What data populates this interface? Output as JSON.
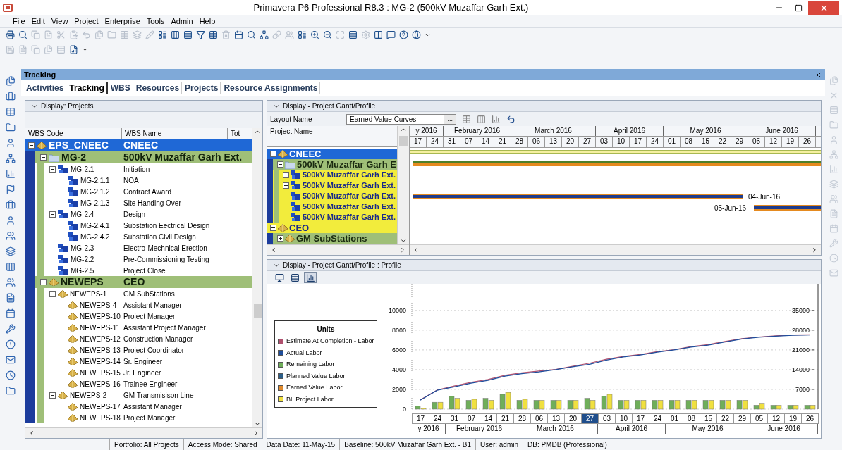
{
  "window": {
    "title": "Primavera P6 Professional R8.3 : MG-2 (500kV Muzaffar Garh Ext.)"
  },
  "menu": [
    "File",
    "Edit",
    "View",
    "Project",
    "Enterprise",
    "Tools",
    "Admin",
    "Help"
  ],
  "panel": {
    "title": "Tracking"
  },
  "tabs": [
    {
      "label": "Activities",
      "selected": false
    },
    {
      "label": "Tracking",
      "selected": true
    },
    {
      "label": "WBS",
      "selected": false
    },
    {
      "label": "Resources",
      "selected": false
    },
    {
      "label": "Projects",
      "selected": false
    },
    {
      "label": "Resource Assignments",
      "selected": false
    }
  ],
  "projects_pane": {
    "header": "Display: Projects",
    "columns": [
      "WBS Code",
      "WBS Name",
      "Tot"
    ],
    "tree": [
      {
        "code": "EPS_CNEEC",
        "name": "CNEEC",
        "kind": "eps",
        "selected": true,
        "expanded": true,
        "children": [
          {
            "code": "MG-2",
            "name": "500kV Muzaffar Garh Ext.",
            "kind": "project",
            "selected": false,
            "expanded": true,
            "children": [
              {
                "code": "MG-2.1",
                "name": "Initiation",
                "kind": "wbs",
                "selected": false,
                "expanded": true,
                "children": [
                  {
                    "code": "MG-2.1.1",
                    "name": "NOA",
                    "kind": "wbs",
                    "selected": false
                  },
                  {
                    "code": "MG-2.1.2",
                    "name": "Contract Award",
                    "kind": "wbs",
                    "selected": false
                  },
                  {
                    "code": "MG-2.1.3",
                    "name": "Site Handing Over",
                    "kind": "wbs",
                    "selected": false
                  }
                ]
              },
              {
                "code": "MG-2.4",
                "name": "Design",
                "kind": "wbs",
                "selected": false,
                "expanded": true,
                "children": [
                  {
                    "code": "MG-2.4.1",
                    "name": "Substation Eectrical Design",
                    "kind": "wbs",
                    "selected": false
                  },
                  {
                    "code": "MG-2.4.2",
                    "name": "Substation Civil Design",
                    "kind": "wbs",
                    "selected": false
                  }
                ]
              },
              {
                "code": "MG-2.3",
                "name": "Electro-Mechnical Erection",
                "kind": "wbs",
                "selected": false
              },
              {
                "code": "MG-2.2",
                "name": "Pre-Commissioning Testing",
                "kind": "wbs",
                "selected": false
              },
              {
                "code": "MG-2.5",
                "name": "Project Close",
                "kind": "wbs",
                "selected": false
              }
            ]
          },
          {
            "code": "NEWEPS",
            "name": "CEO",
            "kind": "eps",
            "selected": false,
            "expanded": true,
            "children": [
              {
                "code": "NEWEPS-1",
                "name": "GM SubStations",
                "kind": "eps",
                "selected": false,
                "expanded": true,
                "children": [
                  {
                    "code": "NEWEPS-4",
                    "name": "Assistant Manager",
                    "kind": "eps",
                    "selected": false
                  },
                  {
                    "code": "NEWEPS-10",
                    "name": "Project Manager",
                    "kind": "eps",
                    "selected": false
                  },
                  {
                    "code": "NEWEPS-11",
                    "name": "Assistant Project Manager",
                    "kind": "eps",
                    "selected": false
                  },
                  {
                    "code": "NEWEPS-12",
                    "name": "Construction Manager",
                    "kind": "eps",
                    "selected": false
                  },
                  {
                    "code": "NEWEPS-13",
                    "name": "Project Coordinator",
                    "kind": "eps",
                    "selected": false
                  },
                  {
                    "code": "NEWEPS-14",
                    "name": "Sr. Engineer",
                    "kind": "eps",
                    "selected": false
                  },
                  {
                    "code": "NEWEPS-15",
                    "name": "Jr. Engineer",
                    "kind": "eps",
                    "selected": false
                  },
                  {
                    "code": "NEWEPS-16",
                    "name": "Trainee Engineer",
                    "kind": "eps",
                    "selected": false
                  }
                ]
              },
              {
                "code": "NEWEPS-2",
                "name": "GM Transmisison Line",
                "kind": "eps",
                "selected": false,
                "expanded": true,
                "children": [
                  {
                    "code": "NEWEPS-17",
                    "name": "Assistant Manager",
                    "kind": "eps",
                    "selected": false
                  },
                  {
                    "code": "NEWEPS-18",
                    "name": "Project Manager",
                    "kind": "eps",
                    "selected": false
                  }
                ]
              }
            ]
          }
        ]
      }
    ]
  },
  "gantt_pane": {
    "header": "Display - Project Gantt/Profile",
    "layout_label": "Layout Name",
    "layout_value": "Earned Value Curves",
    "browse_button": "...",
    "column": "Project Name",
    "months": [
      {
        "label": "y 2016",
        "weeks": [
          "17",
          "24"
        ]
      },
      {
        "label": "February 2016",
        "weeks": [
          "31",
          "07",
          "14",
          "21"
        ]
      },
      {
        "label": "March 2016",
        "weeks": [
          "28",
          "06",
          "13",
          "20",
          "27"
        ]
      },
      {
        "label": "April 2016",
        "weeks": [
          "03",
          "10",
          "17",
          "24"
        ]
      },
      {
        "label": "May 2016",
        "weeks": [
          "01",
          "08",
          "15",
          "22",
          "29"
        ]
      },
      {
        "label": "June 2016",
        "weeks": [
          "05",
          "12",
          "19",
          "26"
        ]
      }
    ],
    "rows": [
      {
        "name": "CNEEC",
        "kind": "eps",
        "selected": true,
        "expanded": true,
        "children": [
          {
            "name": "500kV Muzaffar Garh E",
            "kind": "project",
            "selected": false,
            "expanded": true,
            "children": [
              {
                "name": "500kV Muzaffar Garh Ext.",
                "kind": "wbs",
                "selected": false,
                "expanded": false
              },
              {
                "name": "500kV Muzaffar Garh Ext.",
                "kind": "wbs",
                "selected": false,
                "expanded": false
              },
              {
                "name": "500kV Muzaffar Garh Ext.",
                "kind": "wbs",
                "selected": false,
                "bar_label": "04-Jun-16"
              },
              {
                "name": "500kV Muzaffar Garh Ext.",
                "kind": "wbs",
                "selected": false,
                "bar_label": "05-Jun-16"
              },
              {
                "name": "500kV Muzaffar Garh Ext.",
                "kind": "wbs",
                "selected": false
              }
            ]
          }
        ]
      },
      {
        "name": "CEO",
        "kind": "eps",
        "selected": false,
        "expanded": true,
        "children": [
          {
            "name": "GM SubStations",
            "kind": "eps",
            "selected": false,
            "expanded": false
          }
        ]
      }
    ]
  },
  "profile_pane": {
    "header": "Display - Project Gantt/Profile : Profile",
    "view_buttons": [
      {
        "kind": "monitor",
        "selected": false
      },
      {
        "kind": "table",
        "selected": false
      },
      {
        "kind": "chart",
        "selected": true
      }
    ],
    "legend_title": "Units",
    "week_cells": [
      {
        "selected": false
      },
      {
        "selected": false
      },
      {
        "selected": false
      },
      {
        "selected": false
      },
      {
        "selected": false
      },
      {
        "selected": false
      },
      {
        "selected": false
      },
      {
        "selected": false
      },
      {
        "selected": false
      },
      {
        "selected": false
      },
      {
        "selected": true
      },
      {
        "selected": false
      },
      {
        "selected": false
      },
      {
        "selected": false
      },
      {
        "selected": false
      },
      {
        "selected": false
      },
      {
        "selected": false
      },
      {
        "selected": false
      },
      {
        "selected": false
      },
      {
        "selected": false
      },
      {
        "selected": false
      },
      {
        "selected": false
      },
      {
        "selected": false
      },
      {
        "selected": false
      }
    ],
    "months": [
      "y 2016",
      "February 2016",
      "March 2016",
      "April 2016",
      "May 2016",
      "June 2016"
    ],
    "chart_data": {
      "type": "bar",
      "categories": [
        "17",
        "24",
        "31",
        "07",
        "14",
        "21",
        "28",
        "06",
        "13",
        "20",
        "27",
        "03",
        "10",
        "17",
        "24",
        "01",
        "08",
        "15",
        "22",
        "29",
        "05",
        "12",
        "19",
        "26"
      ],
      "stacked": false,
      "grid": true,
      "legend": true,
      "ylim": [
        0,
        12700
      ],
      "yticks": [
        0,
        2000,
        4000,
        6000,
        8000,
        10000
      ],
      "y2lim": [
        0,
        44450
      ],
      "y2ticks": [
        7000,
        14000,
        21000,
        28000,
        35000
      ],
      "series": [
        {
          "name": "Estimate At Completion - Labor",
          "color": "#b0506e",
          "type": "line",
          "axis": "y2",
          "values": [
            3300,
            6800,
            8200,
            9500,
            10500,
            12000,
            12900,
            13500,
            14100,
            15200,
            16300,
            17700,
            18700,
            19400,
            20400,
            21100,
            22200,
            22900,
            24000,
            25000,
            25600,
            26000,
            26300,
            26400
          ]
        },
        {
          "name": "Actual Labor",
          "color": "#1f4e9c",
          "type": "line",
          "axis": "y2",
          "values": [
            3200,
            6700,
            7900,
            9200,
            10200,
            11700,
            12600,
            13200,
            14000,
            15000,
            15900,
            17400,
            18500,
            19200,
            20200,
            21000,
            22000,
            22700,
            23800,
            24900,
            25500,
            25900,
            26200,
            26300
          ]
        },
        {
          "name": "Remaining Labor",
          "color": "#6fae5a",
          "type": "bar",
          "values": [
            300,
            700,
            1300,
            900,
            1100,
            1500,
            900,
            900,
            900,
            900,
            1100,
            1300,
            900,
            900,
            900,
            900,
            900,
            900,
            900,
            900,
            400,
            400,
            400,
            400
          ]
        },
        {
          "name": "Planned Value Labor",
          "color": "#2c5f8a",
          "type": "line",
          "values": [
            null,
            null,
            null,
            null,
            null,
            null,
            null,
            null,
            null,
            null,
            null,
            null,
            null,
            null,
            null,
            null,
            null,
            null,
            null,
            null,
            null,
            null,
            null,
            null
          ]
        },
        {
          "name": "Earned Value Labor",
          "color": "#e08a2c",
          "type": "line",
          "values": [
            null,
            null,
            null,
            null,
            null,
            null,
            null,
            null,
            null,
            null,
            null,
            null,
            null,
            null,
            null,
            null,
            null,
            null,
            null,
            null,
            null,
            null,
            null,
            null
          ]
        },
        {
          "name": "BL Project Labor",
          "color": "#f0e040",
          "type": "bar",
          "values": [
            100,
            700,
            1100,
            1000,
            900,
            1700,
            1000,
            900,
            900,
            900,
            900,
            1500,
            900,
            900,
            900,
            900,
            900,
            900,
            900,
            900,
            600,
            400,
            400,
            400
          ]
        }
      ]
    }
  },
  "status_bar": [
    "Portfolio: All Projects",
    "Access Mode: Shared",
    "Data Date: 11-May-15",
    "Baseline: 500kV Muzaffar Garh Ext. - B1",
    "User: admin",
    "DB: PMDB (Professional)"
  ]
}
